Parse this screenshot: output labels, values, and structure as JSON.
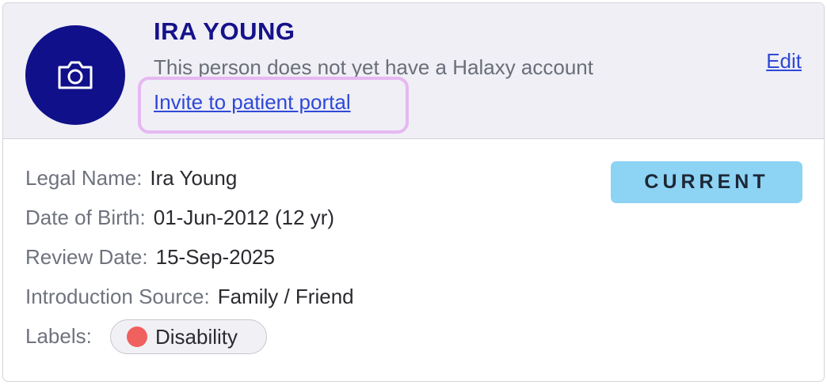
{
  "header": {
    "name": "IRA YOUNG",
    "notice": "This person does not yet have a Halaxy account",
    "invite_link": "Invite to patient portal",
    "edit_link": "Edit",
    "avatar_icon": "camera-icon"
  },
  "details": {
    "legal_name_label": "Legal Name:",
    "legal_name_value": "Ira Young",
    "dob_label": "Date of Birth:",
    "dob_value": "01-Jun-2012 (12 yr)",
    "review_label": "Review Date:",
    "review_value": "15-Sep-2025",
    "source_label": "Introduction Source:",
    "source_value": "Family / Friend",
    "labels_label": "Labels:"
  },
  "status": {
    "text": "CURRENT",
    "color": "#8dd3f4"
  },
  "labels": [
    {
      "text": "Disability",
      "color": "#f0605e"
    }
  ],
  "colors": {
    "brand": "#10108a",
    "link": "#2f48d8",
    "highlight": "#e6b8f2"
  }
}
